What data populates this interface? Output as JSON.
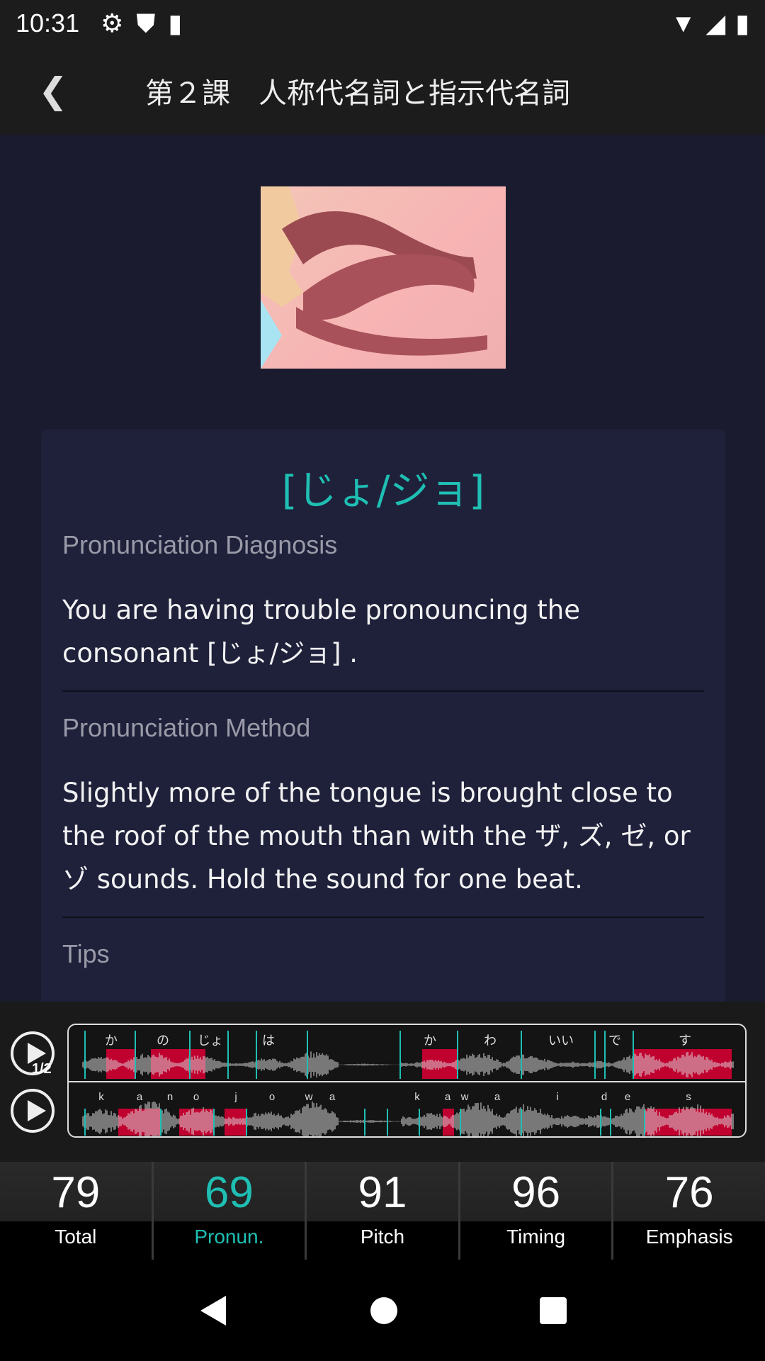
{
  "status": {
    "time": "10:31",
    "icons": [
      "gear-icon",
      "shield-icon",
      "sd-card-icon"
    ],
    "right_icons": [
      "wifi-icon",
      "signal-icon",
      "battery-icon"
    ]
  },
  "header": {
    "title": "第２課　人称代名詞と指示代名詞",
    "back_icon": "chevron-left-icon"
  },
  "card": {
    "phoneme": "[じょ/ジョ]",
    "diagnosis_label": "Pronunciation Diagnosis",
    "diagnosis_text": "You are having trouble pronouncing the consonant [じょ/ジョ] .",
    "method_label": "Pronunciation Method",
    "method_text": "Slightly more of the tongue is brought close to the roof of the mouth than with the ザ, ズ, ゼ, or ゾ sounds. Hold the sound for one beat.",
    "tips_label": "Tips"
  },
  "player": {
    "speed_label": "1/2",
    "kana": [
      "か",
      "の",
      "じょ",
      "は",
      "か",
      "わ",
      "いい",
      "で",
      "す"
    ],
    "phones": [
      "k",
      "a",
      "n",
      "o",
      "j",
      "o",
      "w",
      "a",
      "k",
      "a",
      "w",
      "a",
      "i",
      "d",
      "e",
      "s"
    ]
  },
  "scores": [
    {
      "value": "79",
      "label": "Total"
    },
    {
      "value": "69",
      "label": "Pronun.",
      "active": true
    },
    {
      "value": "91",
      "label": "Pitch"
    },
    {
      "value": "96",
      "label": "Timing"
    },
    {
      "value": "76",
      "label": "Emphasis"
    }
  ],
  "colors": {
    "accent": "#1fbfb3",
    "error": "#c0002f",
    "background": "#1a1b2e",
    "card": "#1f213b"
  }
}
